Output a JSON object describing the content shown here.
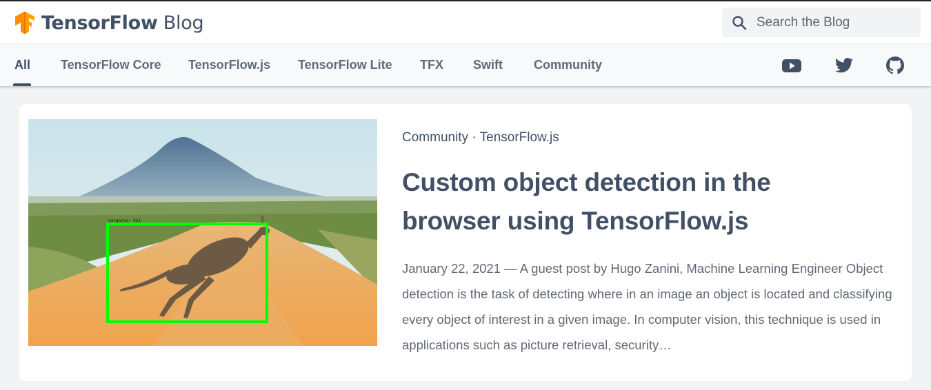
{
  "header": {
    "logo_bold": "TensorFlow",
    "logo_light": "Blog",
    "search_placeholder": "Search the Blog"
  },
  "nav": {
    "tabs": [
      {
        "label": "All",
        "active": true
      },
      {
        "label": "TensorFlow Core"
      },
      {
        "label": "TensorFlow.js"
      },
      {
        "label": "TensorFlow Lite"
      },
      {
        "label": "TFX"
      },
      {
        "label": "Swift"
      },
      {
        "label": "Community"
      }
    ],
    "social": [
      "youtube-icon",
      "twitter-icon",
      "github-icon"
    ]
  },
  "post": {
    "tag1": "Community",
    "separator": " · ",
    "tag2": "TensorFlow.js",
    "title": "Custom object detection in the browser using TensorFlow.js",
    "excerpt": "January 22, 2021 — A guest post by Hugo Zanini, Machine Learning Engineer Object detection is the task of detecting where in an image an object is located and classifying every object of interest in a given image. In computer vision, this technique is used in applications such as picture retrieval, security…",
    "image_label": "kangaroo: 921"
  },
  "colors": {
    "brand_orange": "#ff8f00",
    "text_slate": "#425066",
    "box_green": "#00ff00"
  }
}
